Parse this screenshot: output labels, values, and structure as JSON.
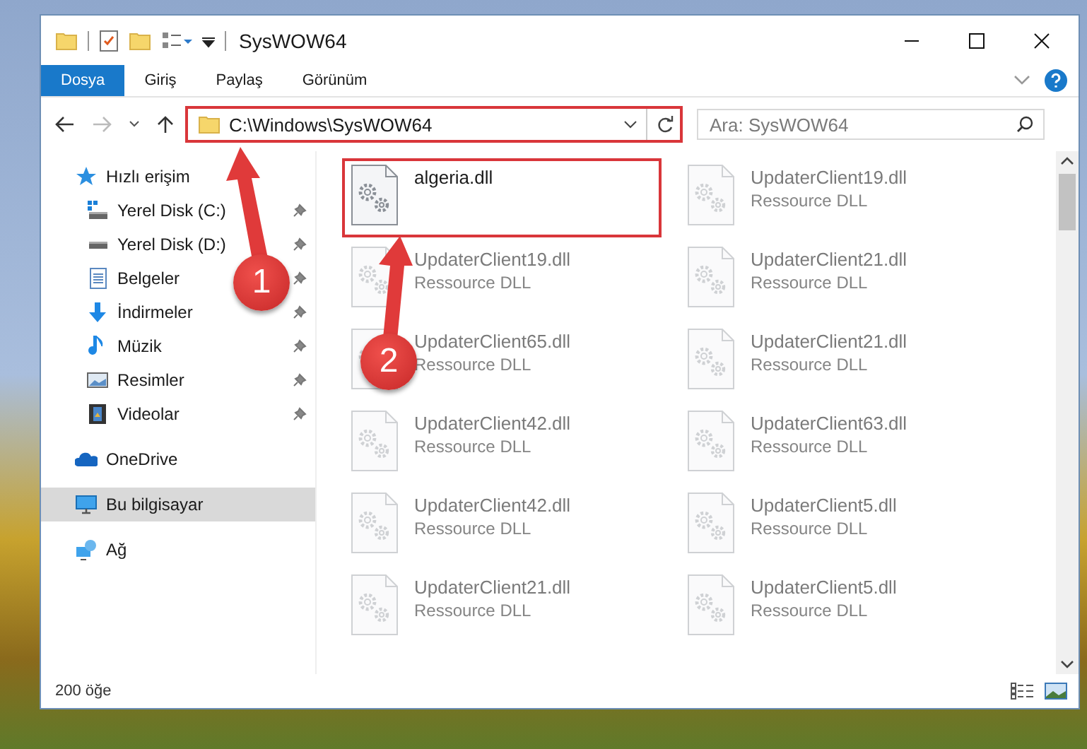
{
  "window": {
    "title": "SysWOW64"
  },
  "ribbon_tabs": [
    {
      "label": "Dosya",
      "selected": true
    },
    {
      "label": "Giriş",
      "selected": false
    },
    {
      "label": "Paylaş",
      "selected": false
    },
    {
      "label": "Görünüm",
      "selected": false
    }
  ],
  "address": {
    "path": "C:\\Windows\\SysWOW64",
    "highlighted": true
  },
  "search": {
    "placeholder": "Ara: SysWOW64"
  },
  "sidebar": {
    "items": [
      {
        "label": "Hızlı erişim",
        "kind": "star",
        "selected": false,
        "children": [
          {
            "label": "Yerel Disk (C:)",
            "kind": "drive-c",
            "pinned": true
          },
          {
            "label": "Yerel Disk (D:)",
            "kind": "drive",
            "pinned": true
          },
          {
            "label": "Belgeler",
            "kind": "doc",
            "pinned": true
          },
          {
            "label": "İndirmeler",
            "kind": "download",
            "pinned": true
          },
          {
            "label": "Müzik",
            "kind": "music",
            "pinned": true
          },
          {
            "label": "Resimler",
            "kind": "pictures",
            "pinned": true
          },
          {
            "label": "Videolar",
            "kind": "video",
            "pinned": true
          }
        ]
      },
      {
        "label": "OneDrive",
        "kind": "cloud",
        "selected": false
      },
      {
        "label": "Bu bilgisayar",
        "kind": "computer",
        "selected": true
      },
      {
        "label": "Ağ",
        "kind": "network",
        "selected": false
      }
    ]
  },
  "files": [
    {
      "name": "algeria.dll",
      "highlighted": true,
      "blurred": false
    },
    {
      "name": "UpdaterClient19.dll",
      "type": "Ressource DLL",
      "highlighted": false,
      "blurred": true
    },
    {
      "name": "UpdaterClient19.dll",
      "type": "Ressource DLL",
      "highlighted": false,
      "blurred": true
    },
    {
      "name": "UpdaterClient21.dll",
      "type": "Ressource DLL",
      "highlighted": false,
      "blurred": true
    },
    {
      "name": "UpdaterClient65.dll",
      "type": "Ressource DLL",
      "highlighted": false,
      "blurred": true
    },
    {
      "name": "UpdaterClient21.dll",
      "type": "Ressource DLL",
      "highlighted": false,
      "blurred": true
    },
    {
      "name": "UpdaterClient42.dll",
      "type": "Ressource DLL",
      "highlighted": false,
      "blurred": true
    },
    {
      "name": "UpdaterClient63.dll",
      "type": "Ressource DLL",
      "highlighted": false,
      "blurred": true
    },
    {
      "name": "UpdaterClient42.dll",
      "type": "Ressource DLL",
      "highlighted": false,
      "blurred": true
    },
    {
      "name": "UpdaterClient5.dll",
      "type": "Ressource DLL",
      "highlighted": false,
      "blurred": true
    },
    {
      "name": "UpdaterClient21.dll",
      "type": "Ressource DLL",
      "highlighted": false,
      "blurred": true
    },
    {
      "name": "UpdaterClient5.dll",
      "type": "Ressource DLL",
      "highlighted": false,
      "blurred": true
    }
  ],
  "status_bar": {
    "count": "200 öğe"
  },
  "annotations": [
    {
      "number": "1"
    },
    {
      "number": "2"
    }
  ]
}
